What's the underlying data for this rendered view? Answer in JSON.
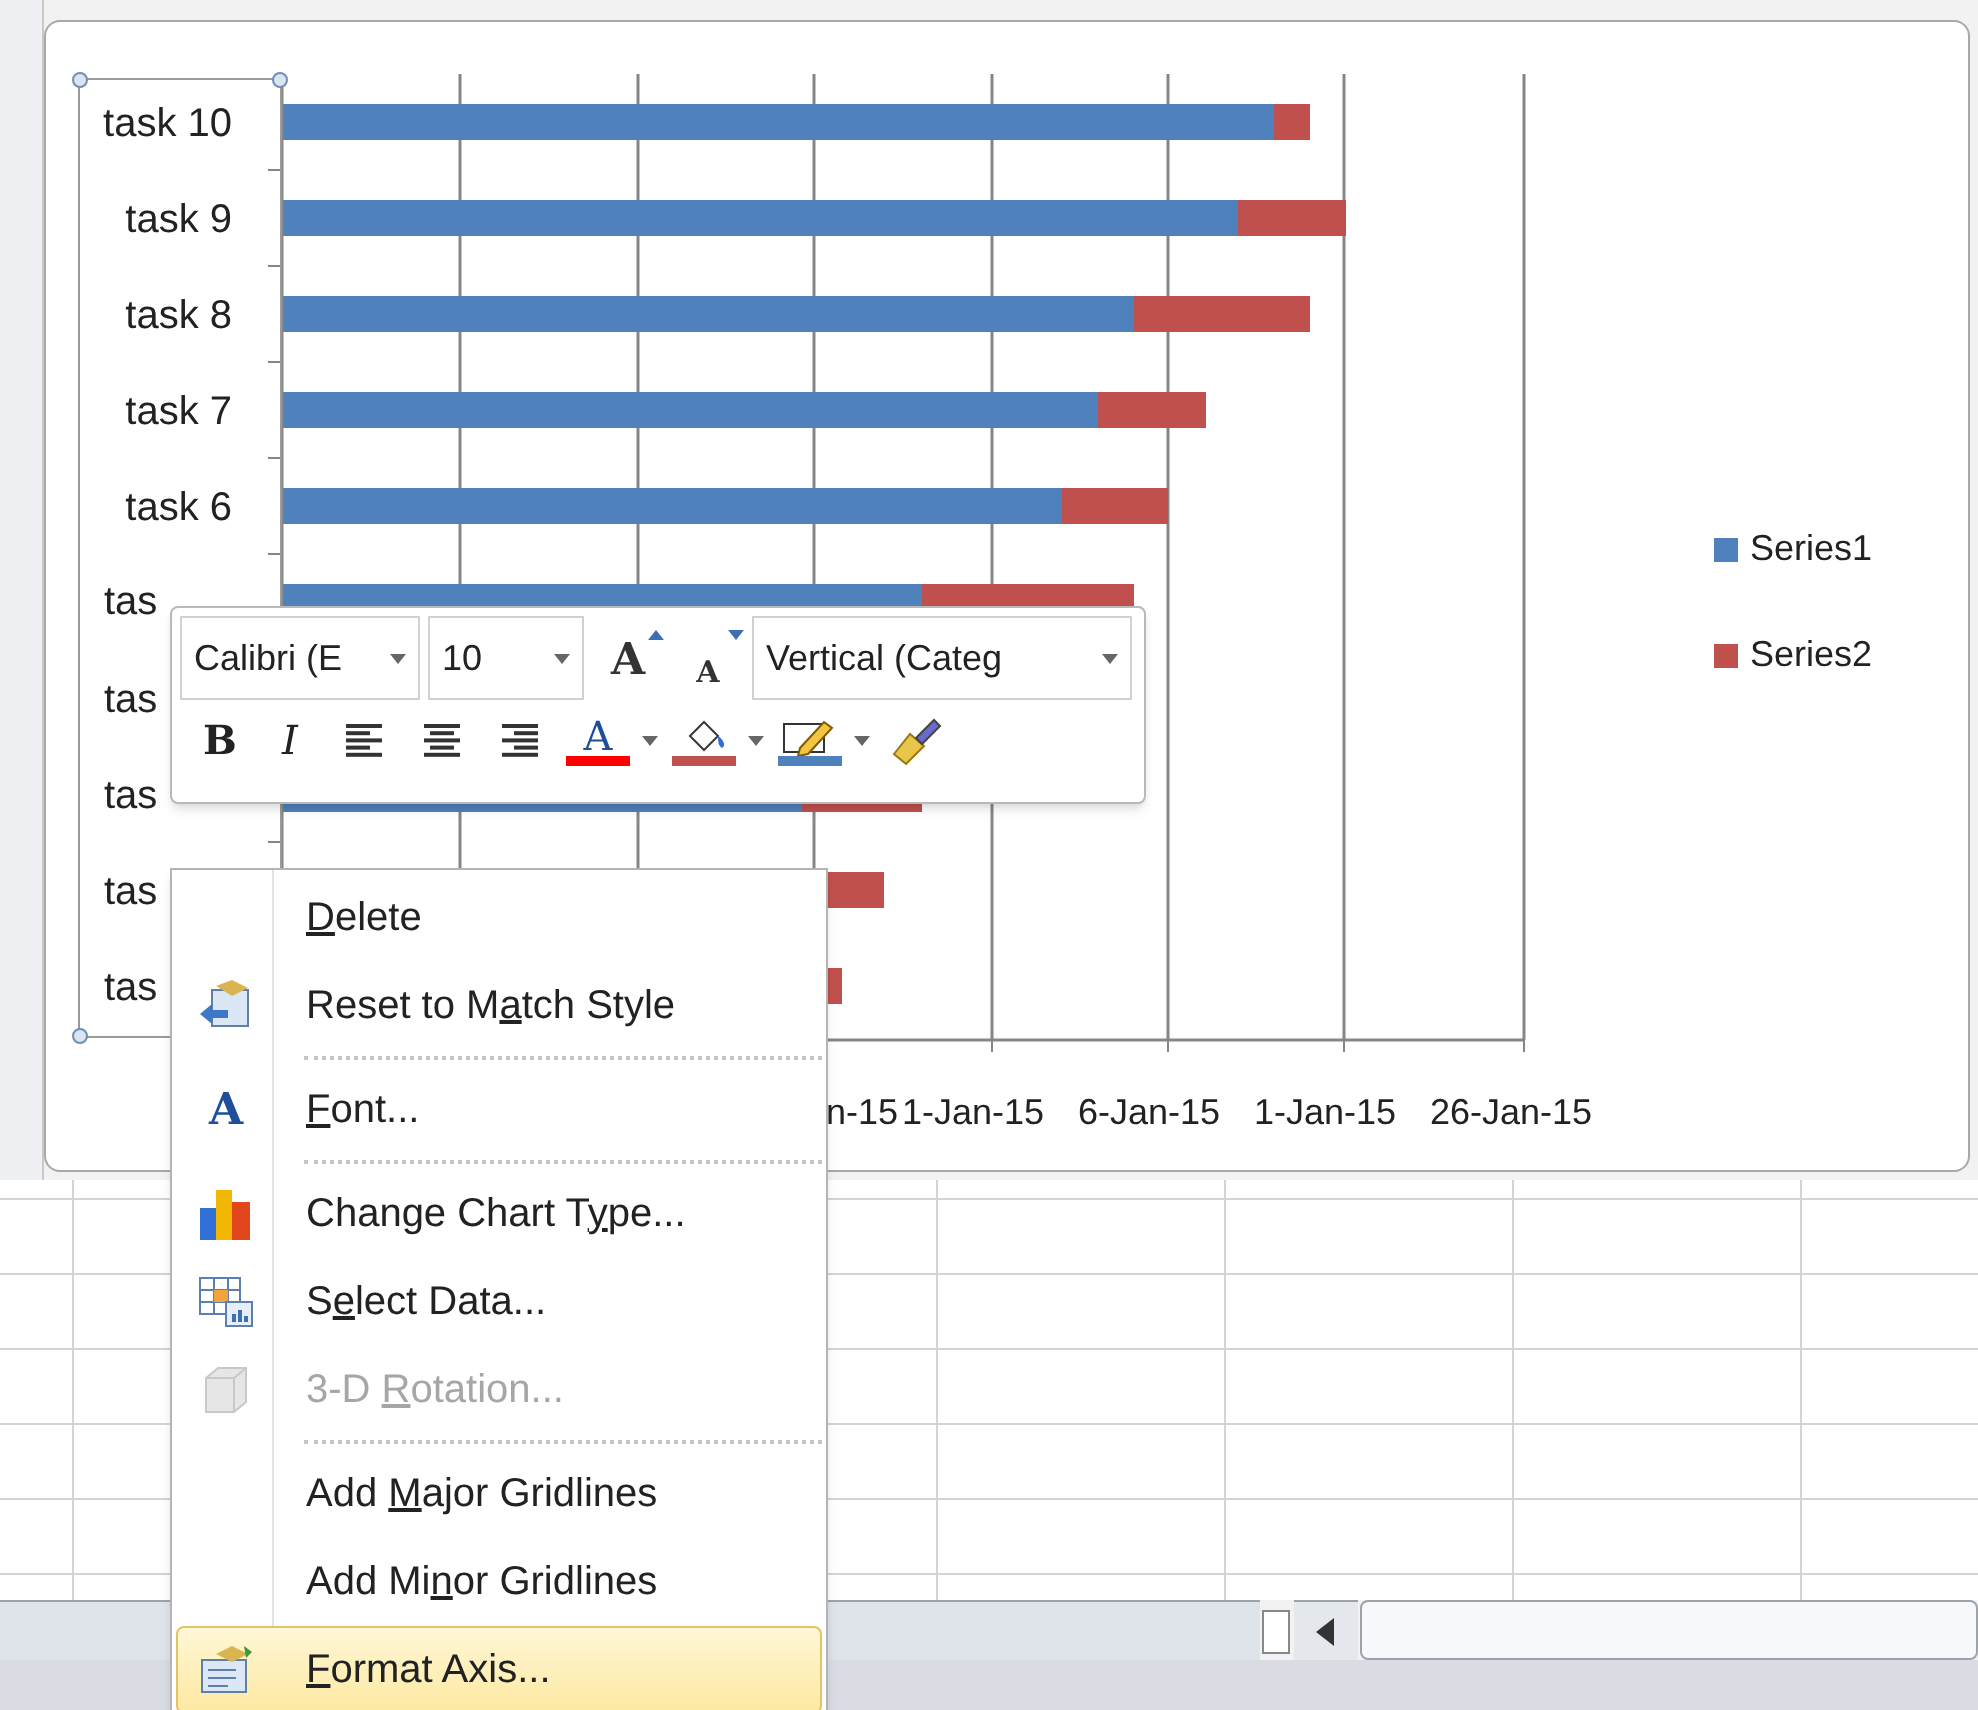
{
  "chart": {
    "category_labels": [
      "task 10",
      "task 9",
      "task 8",
      "task 7",
      "task 6",
      "tas",
      "tas",
      "tas",
      "tas",
      "tas"
    ],
    "axis_labels": [
      "n-15",
      "1-Jan-15",
      "6-Jan-15",
      "1-Jan-15",
      "26-Jan-15"
    ],
    "legend": [
      {
        "name": "Series1",
        "color": "#4f81bd"
      },
      {
        "name": "Series2",
        "color": "#c0504d"
      }
    ]
  },
  "mini_toolbar": {
    "font": "Calibri (E",
    "size": "10",
    "element": "Vertical (Categ",
    "buttons": [
      {
        "kind": "bold",
        "glyph": "B"
      },
      {
        "kind": "italic",
        "glyph": "I"
      },
      {
        "kind": "align"
      },
      {
        "kind": "align"
      },
      {
        "kind": "align"
      },
      {
        "kind": "fontcolor",
        "glyph": "A",
        "color": "#ff0000"
      },
      {
        "kind": "fill",
        "color": "#c0504d"
      },
      {
        "kind": "outline",
        "color": "#4f81bd"
      },
      {
        "kind": "brush"
      }
    ],
    "grow_glyph": "A",
    "shrink_glyph": "A"
  },
  "context_menu": [
    {
      "kind": "item",
      "key": "D",
      "after": "elete",
      "disabled": false,
      "selected": false
    },
    {
      "kind": "item",
      "before": "Reset to M",
      "key": "a",
      "after": "tch Style",
      "disabled": false,
      "selected": false
    },
    {
      "kind": "separator"
    },
    {
      "kind": "item",
      "key": "F",
      "after": "ont...",
      "icon_glyph": "A",
      "disabled": false,
      "selected": false
    },
    {
      "kind": "separator"
    },
    {
      "kind": "item",
      "before": "Change Chart T",
      "key": "y",
      "after": "pe...",
      "disabled": false,
      "selected": false
    },
    {
      "kind": "item",
      "before": "S",
      "key": "e",
      "after": "lect Data...",
      "disabled": false,
      "selected": false
    },
    {
      "kind": "item",
      "before": "3-D ",
      "key": "R",
      "after": "otation...",
      "disabled": true,
      "selected": false
    },
    {
      "kind": "separator"
    },
    {
      "kind": "item",
      "before": "Add ",
      "key": "M",
      "after": "ajor Gridlines",
      "disabled": false,
      "selected": false
    },
    {
      "kind": "item",
      "before": "Add Mi",
      "key": "n",
      "after": "or Gridlines",
      "disabled": false,
      "selected": false
    },
    {
      "kind": "item",
      "key": "F",
      "after": "ormat Axis...",
      "disabled": false,
      "selected": true
    }
  ]
}
